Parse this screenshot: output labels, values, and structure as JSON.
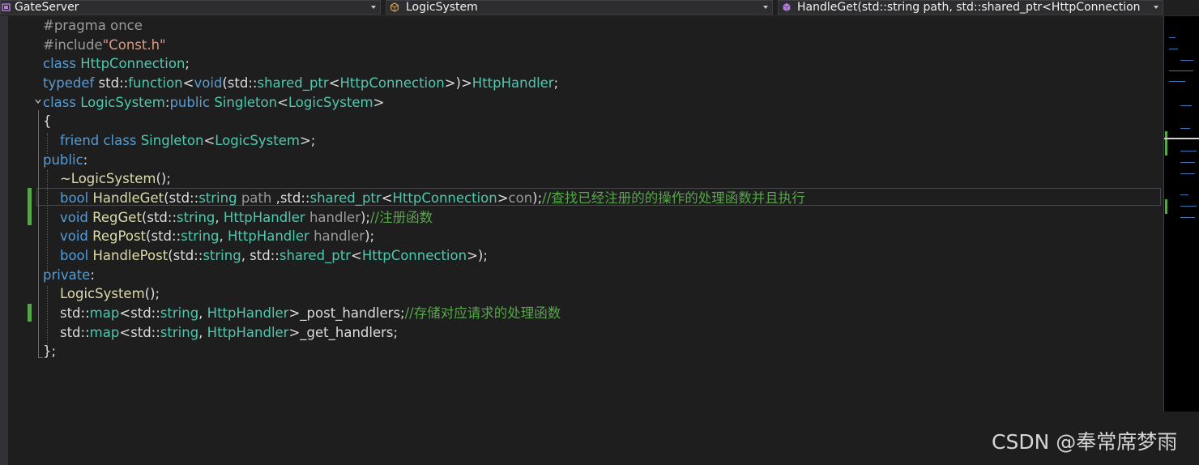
{
  "navbar": {
    "project": "GateServer",
    "scope": "LogicSystem",
    "member": "HandleGet(std::string path, std::shared_ptr<HttpConnection"
  },
  "code": {
    "lines": [
      [
        [
          "c-pre",
          "#pragma once"
        ]
      ],
      [
        [
          "c-pre",
          "#include"
        ],
        [
          "c-str",
          "\"Const.h\""
        ]
      ],
      [
        [
          "c-kw",
          "class "
        ],
        [
          "c-type",
          "HttpConnection"
        ],
        [
          "c-plain",
          ";"
        ]
      ],
      [
        [
          "c-kw",
          "typedef "
        ],
        [
          "c-plain",
          "std::"
        ],
        [
          "c-type",
          "function"
        ],
        [
          "c-plain",
          "<"
        ],
        [
          "c-kw",
          "void"
        ],
        [
          "c-plain",
          "(std::"
        ],
        [
          "c-type",
          "shared_ptr"
        ],
        [
          "c-plain",
          "<"
        ],
        [
          "c-type",
          "HttpConnection"
        ],
        [
          "c-plain",
          ">)>"
        ],
        [
          "c-type",
          "HttpHandler"
        ],
        [
          "c-plain",
          ";"
        ]
      ],
      [
        [
          "c-kw",
          "class "
        ],
        [
          "c-type",
          "LogicSystem"
        ],
        [
          "c-plain",
          ":"
        ],
        [
          "c-kw",
          "public "
        ],
        [
          "c-type",
          "Singleton"
        ],
        [
          "c-plain",
          "<"
        ],
        [
          "c-type",
          "LogicSystem"
        ],
        [
          "c-plain",
          ">"
        ]
      ],
      [
        [
          "c-plain",
          "{"
        ]
      ],
      [
        [
          "c-plain",
          "    "
        ],
        [
          "c-kw",
          "friend class "
        ],
        [
          "c-type",
          "Singleton"
        ],
        [
          "c-plain",
          "<"
        ],
        [
          "c-type",
          "LogicSystem"
        ],
        [
          "c-plain",
          ">;"
        ]
      ],
      [
        [
          "c-kw",
          "public"
        ],
        [
          "c-plain",
          ":"
        ]
      ],
      [
        [
          "c-plain",
          "    "
        ],
        [
          "c-func",
          "~LogicSystem"
        ],
        [
          "c-plain",
          "();"
        ]
      ],
      [
        [
          "c-plain",
          "    "
        ],
        [
          "c-kw",
          "bool "
        ],
        [
          "c-func",
          "HandleGet"
        ],
        [
          "c-plain",
          "(std::"
        ],
        [
          "c-type",
          "string "
        ],
        [
          "c-param",
          "path "
        ],
        [
          "c-plain",
          ",std::"
        ],
        [
          "c-type",
          "shared_ptr"
        ],
        [
          "c-plain",
          "<"
        ],
        [
          "c-type",
          "HttpConnection"
        ],
        [
          "c-plain",
          ">"
        ],
        [
          "c-param",
          "con"
        ],
        [
          "c-plain",
          ");"
        ],
        [
          "c-comment",
          "//查找已经注册的的操作的处理函数并且执行"
        ]
      ],
      [
        [
          "c-plain",
          "    "
        ],
        [
          "c-kw",
          "void "
        ],
        [
          "c-func",
          "RegGet"
        ],
        [
          "c-plain",
          "(std::"
        ],
        [
          "c-type",
          "string"
        ],
        [
          "c-plain",
          ", "
        ],
        [
          "c-type",
          "HttpHandler "
        ],
        [
          "c-param",
          "handler"
        ],
        [
          "c-plain",
          ");"
        ],
        [
          "c-comment",
          "//注册函数"
        ]
      ],
      [
        [
          "c-plain",
          "    "
        ],
        [
          "c-kw",
          "void "
        ],
        [
          "c-func",
          "RegPost"
        ],
        [
          "c-plain",
          "(std::"
        ],
        [
          "c-type",
          "string"
        ],
        [
          "c-plain",
          ", "
        ],
        [
          "c-type",
          "HttpHandler "
        ],
        [
          "c-param",
          "handler"
        ],
        [
          "c-plain",
          ");"
        ]
      ],
      [
        [
          "c-plain",
          "    "
        ],
        [
          "c-kw",
          "bool "
        ],
        [
          "c-func",
          "HandlePost"
        ],
        [
          "c-plain",
          "(std::"
        ],
        [
          "c-type",
          "string"
        ],
        [
          "c-plain",
          ", std::"
        ],
        [
          "c-type",
          "shared_ptr"
        ],
        [
          "c-plain",
          "<"
        ],
        [
          "c-type",
          "HttpConnection"
        ],
        [
          "c-plain",
          ">);"
        ]
      ],
      [
        [
          "c-kw",
          "private"
        ],
        [
          "c-plain",
          ":"
        ]
      ],
      [
        [
          "c-plain",
          "    "
        ],
        [
          "c-func",
          "LogicSystem"
        ],
        [
          "c-plain",
          "();"
        ]
      ],
      [
        [
          "c-plain",
          "    std::"
        ],
        [
          "c-type",
          "map"
        ],
        [
          "c-plain",
          "<std::"
        ],
        [
          "c-type",
          "string"
        ],
        [
          "c-plain",
          ", "
        ],
        [
          "c-type",
          "HttpHandler"
        ],
        [
          "c-plain",
          ">_post_handlers;"
        ],
        [
          "c-comment",
          "//存储对应请求的处理函数"
        ]
      ],
      [
        [
          "c-plain",
          "    std::"
        ],
        [
          "c-type",
          "map"
        ],
        [
          "c-plain",
          "<std::"
        ],
        [
          "c-type",
          "string"
        ],
        [
          "c-plain",
          ", "
        ],
        [
          "c-type",
          "HttpHandler"
        ],
        [
          "c-plain",
          ">_get_handlers;"
        ]
      ],
      [
        [
          "c-plain",
          "};"
        ]
      ]
    ]
  },
  "watermark": "CSDN @奉常席梦雨",
  "colors": {
    "background": "#1e1e1e",
    "keyword": "#569cd6",
    "type": "#4ec9b0",
    "function": "#dcdcaa",
    "string": "#d69d85",
    "comment": "#57a64a",
    "preprocessor": "#9b9b9b",
    "change_marker": "#57a64a"
  },
  "icons": {
    "project": "project-icon",
    "scope": "class-icon",
    "member": "method-icon",
    "fold": "collapse-chevron-icon"
  }
}
